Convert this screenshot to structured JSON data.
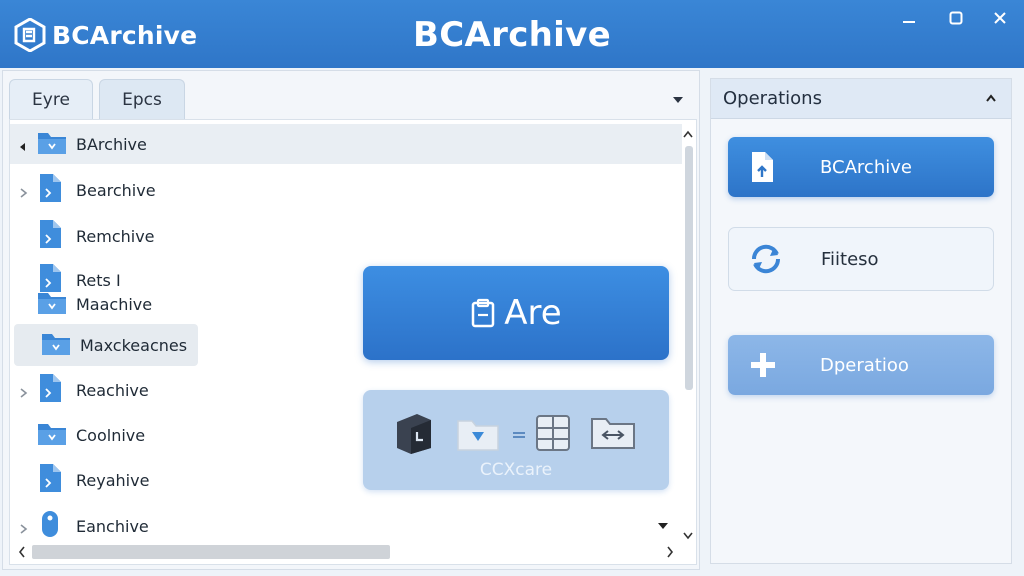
{
  "window": {
    "logo_text": "BCArchive",
    "title": "BCArchive",
    "controls": {
      "minimize": "minimize",
      "maximize": "maximize",
      "close": "close"
    }
  },
  "left_panel": {
    "tabs": [
      {
        "label": "Eyre"
      },
      {
        "label": "Epcs"
      }
    ],
    "tree": [
      {
        "label": "BArchive",
        "icon": "folder-icon",
        "expander": "expanded"
      },
      {
        "label": "Bearchive",
        "icon": "document-icon",
        "expander": "collapsed"
      },
      {
        "label": "Remchive",
        "icon": "document-icon",
        "expander": "none"
      },
      {
        "label": "Rets I",
        "icon": "document-icon",
        "expander": "none"
      },
      {
        "label": "Maachive",
        "icon": "folder-icon",
        "expander": "none"
      },
      {
        "label": "Maxckeacnes",
        "icon": "folder-icon",
        "expander": "none"
      },
      {
        "label": "Reachive",
        "icon": "document-icon",
        "expander": "collapsed"
      },
      {
        "label": "Coolnive",
        "icon": "folder-icon",
        "expander": "none"
      },
      {
        "label": "Reyahive",
        "icon": "document-icon",
        "expander": "none"
      },
      {
        "label": "Eanchive",
        "icon": "drive-icon",
        "expander": "collapsed"
      }
    ],
    "archive_button": {
      "label": "Are",
      "icon": "archive-icon"
    },
    "convert_card": {
      "label": "CCXcare"
    }
  },
  "right_panel": {
    "header": "Operations",
    "buttons": [
      {
        "label": "BCArchive",
        "icon": "upload-file-icon"
      },
      {
        "label": "Fiiteso",
        "icon": "refresh-icon"
      },
      {
        "label": "Dperatioo",
        "icon": "plus-icon"
      }
    ]
  },
  "colors": {
    "accent": "#2f76c8",
    "panel": "#f3f6fa",
    "highlight": "#e9eef3"
  }
}
